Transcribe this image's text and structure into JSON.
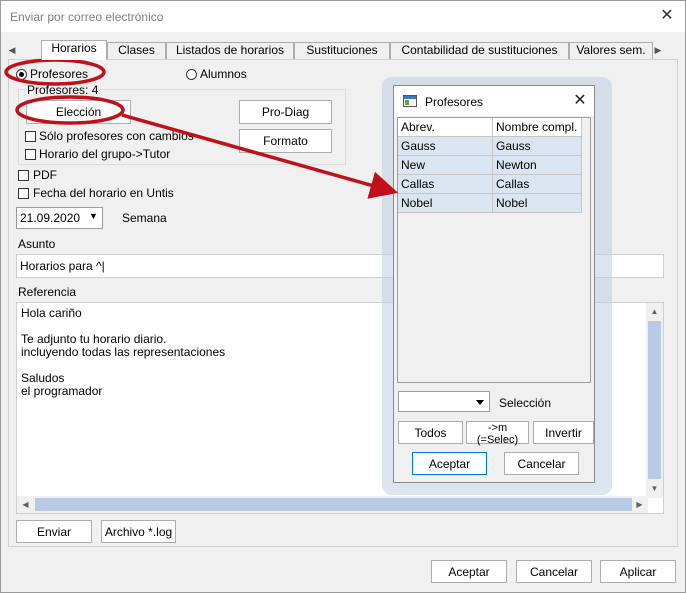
{
  "window": {
    "title": "Enviar por correo electrónico",
    "close": "✕"
  },
  "tabs": [
    {
      "label": "Horarios"
    },
    {
      "label": "Clases"
    },
    {
      "label": "Listados de horarios"
    },
    {
      "label": "Sustituciones"
    },
    {
      "label": "Contabilidad de sustituciones"
    },
    {
      "label": "Valores sem."
    }
  ],
  "tab_arrows": {
    "left": "◀",
    "right": "▶"
  },
  "radios": {
    "teachers": "Profesores",
    "students": "Alumnos"
  },
  "group": {
    "count_label": "Profesores: 4",
    "selection_button": "Elección",
    "changed_only": "Sólo profesores con cambios",
    "group_tutor": "Horario del grupo->Tutor"
  },
  "buttons": {
    "pro_diag": "Pro-Diag",
    "formato": "Formato",
    "enviar": "Enviar",
    "archivo": "Archivo *.log",
    "aceptar": "Aceptar",
    "cancelar": "Cancelar",
    "aplicar": "Aplicar"
  },
  "options": {
    "pdf": "PDF",
    "untis_date": "Fecha del horario en Untis"
  },
  "date": {
    "value": "21.09.2020",
    "period": "Semana"
  },
  "subject": {
    "label": "Asunto",
    "value": "Horarios para ^|"
  },
  "reference": {
    "label": "Referencia",
    "lines": [
      "Hola cariño",
      "",
      "Te adjunto tu horario diario.",
      "incluyendo todas las representaciones",
      "",
      "Saludos",
      "el programador"
    ]
  },
  "dialog": {
    "title": "Profesores",
    "close": "✕",
    "columns": [
      "Abrev.",
      "Nombre compl."
    ],
    "rows": [
      [
        "Gauss",
        "Gauss"
      ],
      [
        "New",
        "Newton"
      ],
      [
        "Callas",
        "Callas"
      ],
      [
        "Nobel",
        "Nobel"
      ]
    ],
    "selection_label": "Selección",
    "btn_all": "Todos",
    "btn_select": "->m (=Selec)",
    "btn_invert": "Invertir",
    "btn_ok": "Aceptar",
    "btn_cancel": "Cancelar"
  },
  "colors": {
    "annotation": "#c0111b",
    "selection_row": "#dbe5f2",
    "scroll_thumb": "#b9cbe4"
  }
}
